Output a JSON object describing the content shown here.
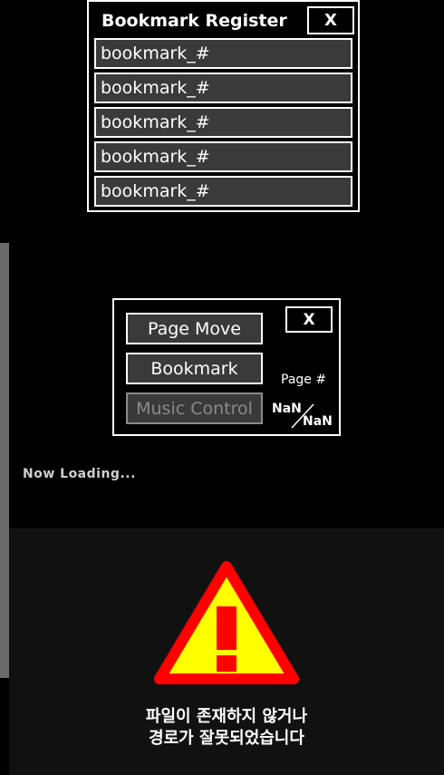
{
  "bookmark_register": {
    "title": "Bookmark Register",
    "close_label": "X",
    "slots": [
      "bookmark_#",
      "bookmark_#",
      "bookmark_#",
      "bookmark_#",
      "bookmark_#"
    ]
  },
  "menu": {
    "close_label": "X",
    "page_move_label": "Page Move",
    "bookmark_label": "Bookmark",
    "music_control_label": "Music Control",
    "page_label": "Page #",
    "current_page": "NaN",
    "total_pages": "NaN"
  },
  "loading_text": "Now Loading...",
  "error": {
    "icon": "warning-icon",
    "line1": "파일이 존재하지 않거나",
    "line2": "경로가 잘못되었습니다"
  },
  "colors": {
    "warning_fill": "#ffff00",
    "warning_border": "#ff0000",
    "disabled_text": "#8a8a8a"
  }
}
